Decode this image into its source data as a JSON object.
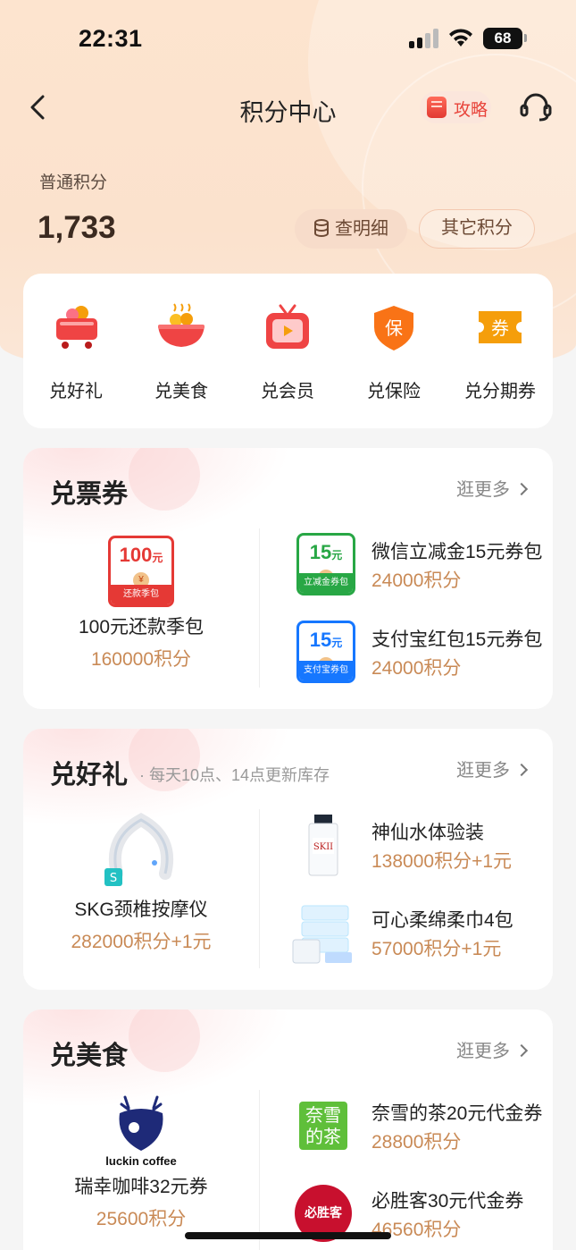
{
  "status": {
    "time": "22:31",
    "battery": "68"
  },
  "nav": {
    "title": "积分中心",
    "guide_label": "攻略"
  },
  "points": {
    "label": "普通积分",
    "value": "1,733",
    "detail_button": "查明细",
    "other_button": "其它积分"
  },
  "categories": [
    {
      "label": "兑好礼",
      "icon": "gift-cart-icon"
    },
    {
      "label": "兑美食",
      "icon": "noodle-bowl-icon"
    },
    {
      "label": "兑会员",
      "icon": "tv-icon"
    },
    {
      "label": "兑保险",
      "icon": "shield-icon"
    },
    {
      "label": "兑分期券",
      "icon": "ticket-icon"
    }
  ],
  "tickets": {
    "title": "兑票券",
    "more": "逛更多",
    "featured": {
      "name": "100元还款季包",
      "price": "160000积分",
      "badge_amount": "100",
      "badge_unit": "元",
      "badge_caption": "还款季包"
    },
    "items": [
      {
        "name": "微信立减金15元券包",
        "price": "24000积分",
        "badge_amount": "15",
        "badge_unit": "元",
        "badge_caption": "立减金券包",
        "color": "#28a745"
      },
      {
        "name": "支付宝红包15元券包",
        "price": "24000积分",
        "badge_amount": "15",
        "badge_unit": "元",
        "badge_caption": "支付宝券包",
        "color": "#1677ff"
      }
    ]
  },
  "gifts": {
    "title": "兑好礼",
    "subtitle": "· 每天10点、14点更新库存",
    "more": "逛更多",
    "featured": {
      "name": "SKG颈椎按摩仪",
      "price": "282000积分+1元"
    },
    "items": [
      {
        "name": "神仙水体验装",
        "price": "138000积分+1元"
      },
      {
        "name": "可心柔绵柔巾4包",
        "price": "57000积分+1元"
      }
    ]
  },
  "food": {
    "title": "兑美食",
    "more": "逛更多",
    "featured": {
      "name": "瑞幸咖啡32元券",
      "price": "25600积分",
      "logo_text": "luckin coffee"
    },
    "items": [
      {
        "name": "奈雪的茶20元代金券",
        "price": "28800积分",
        "logo_text": "奈雪的茶"
      },
      {
        "name": "必胜客30元代金券",
        "price": "46560积分",
        "logo_text": "必胜客"
      }
    ]
  }
}
